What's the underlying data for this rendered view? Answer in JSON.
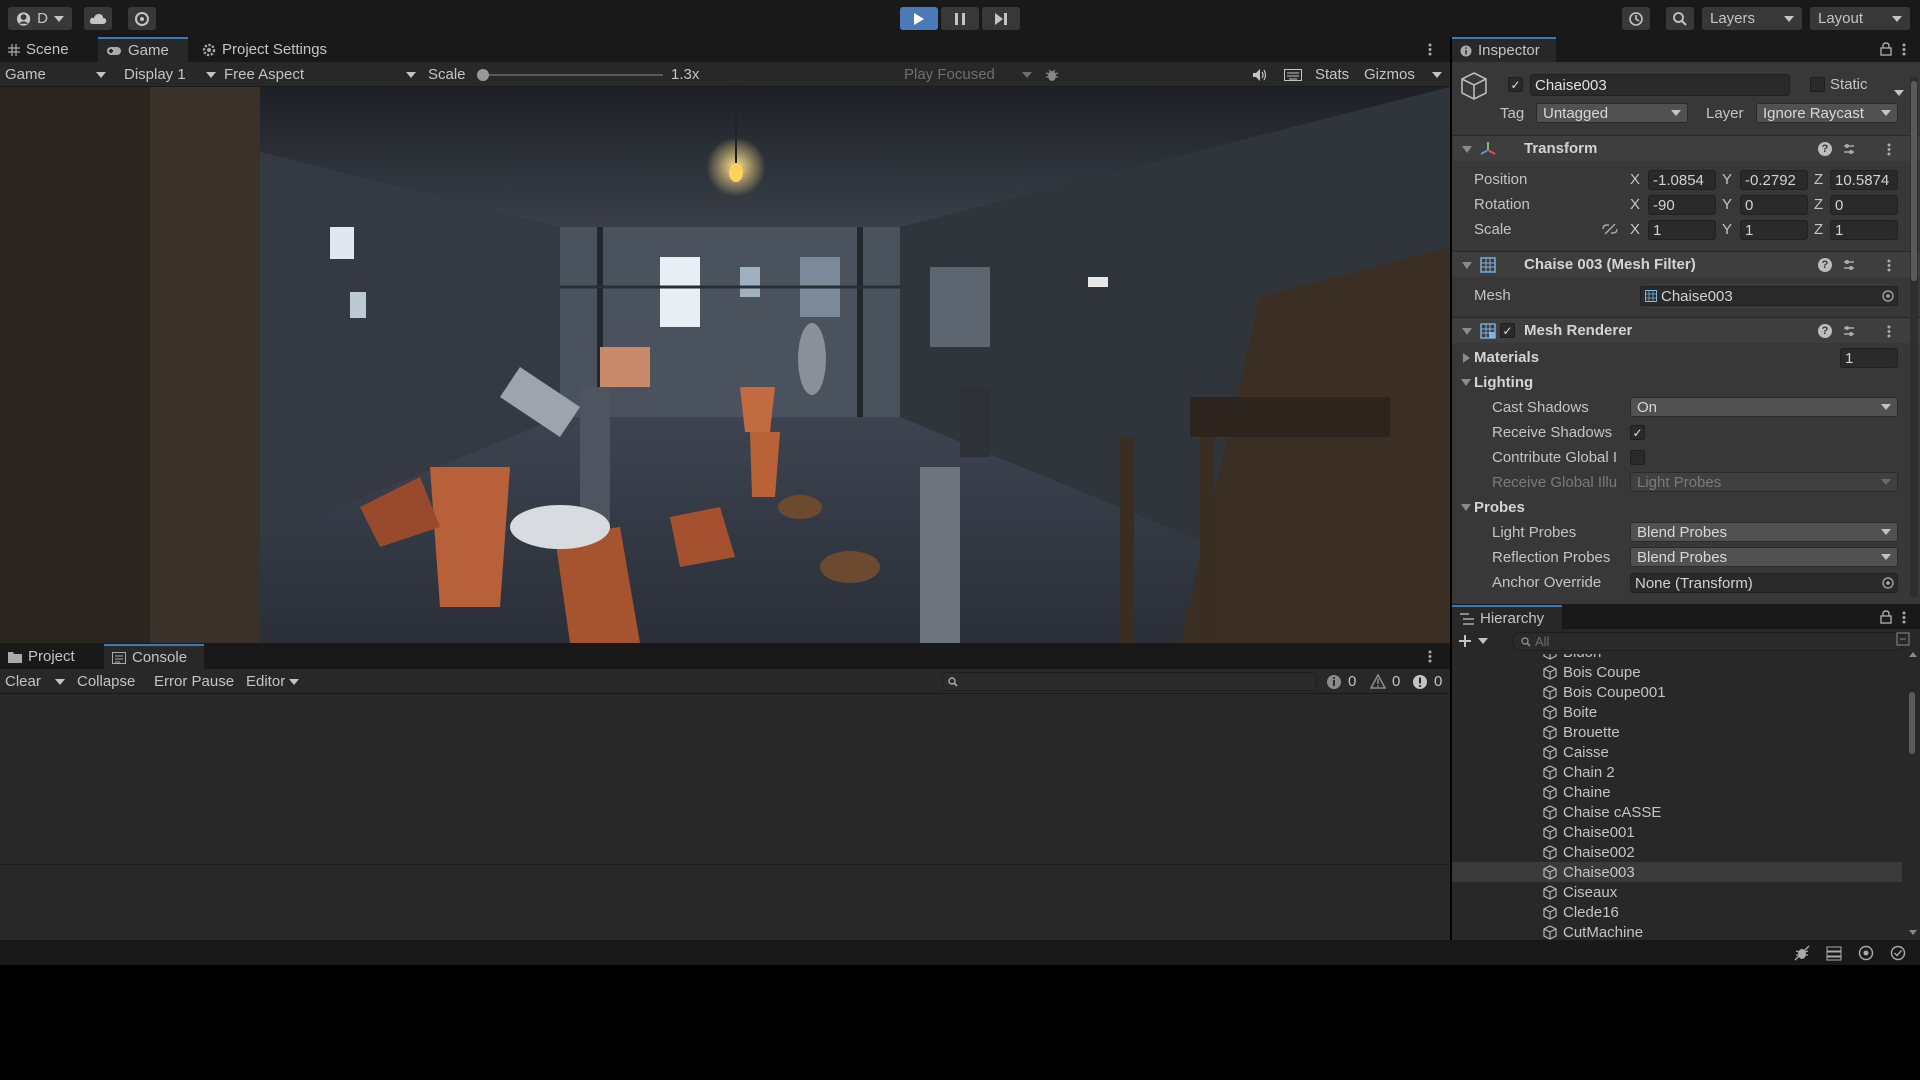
{
  "toolbar": {
    "account_initial": "D",
    "layers_label": "Layers",
    "layout_label": "Layout"
  },
  "left_tabs": [
    {
      "label": "Scene"
    },
    {
      "label": "Game"
    },
    {
      "label": "Project Settings"
    }
  ],
  "game_toolbar": {
    "mode": "Game",
    "display": "Display 1",
    "aspect": "Free Aspect",
    "scale_label": "Scale",
    "scale_value": "1.3x",
    "play_mode": "Play Focused",
    "stats": "Stats",
    "gizmos": "Gizmos"
  },
  "console_tabs": [
    {
      "label": "Project"
    },
    {
      "label": "Console"
    }
  ],
  "console_toolbar": {
    "clear": "Clear",
    "collapse": "Collapse",
    "error_pause": "Error Pause",
    "editor": "Editor",
    "log_count": "0",
    "warning_count": "0",
    "error_count": "0"
  },
  "inspector": {
    "tab": "Inspector",
    "object_name": "Chaise003",
    "static_label": "Static",
    "tag_label": "Tag",
    "tag_value": "Untagged",
    "layer_label": "Layer",
    "layer_value": "Ignore Raycast",
    "transform": {
      "title": "Transform",
      "position_label": "Position",
      "rotation_label": "Rotation",
      "scale_label": "Scale",
      "position": {
        "x": "-1.0854",
        "y": "-0.2792",
        "z": "10.5874"
      },
      "rotation": {
        "x": "-90",
        "y": "0",
        "z": "0"
      },
      "scale": {
        "x": "1",
        "y": "1",
        "z": "1"
      }
    },
    "mesh_filter": {
      "title": "Chaise 003 (Mesh Filter)",
      "mesh_label": "Mesh",
      "mesh_value": "Chaise003"
    },
    "mesh_renderer": {
      "title": "Mesh Renderer",
      "materials_label": "Materials",
      "materials_count": "1",
      "lighting_label": "Lighting",
      "cast_shadows_label": "Cast Shadows",
      "cast_shadows_value": "On",
      "receive_shadows_label": "Receive Shadows",
      "contribute_gi_label": "Contribute Global I",
      "receive_gi_label": "Receive Global Illu",
      "receive_gi_value": "Light Probes",
      "probes_label": "Probes",
      "light_probes_label": "Light Probes",
      "light_probes_value": "Blend Probes",
      "reflection_probes_label": "Reflection Probes",
      "reflection_probes_value": "Blend Probes",
      "anchor_override_label": "Anchor Override",
      "anchor_override_value": "None (Transform)"
    }
  },
  "hierarchy": {
    "tab": "Hierarchy",
    "search_placeholder": "All",
    "items": [
      {
        "label": "Bidon"
      },
      {
        "label": "Bois Coupe"
      },
      {
        "label": "Bois Coupe001"
      },
      {
        "label": "Boite"
      },
      {
        "label": "Brouette"
      },
      {
        "label": "Caisse"
      },
      {
        "label": "Chain 2"
      },
      {
        "label": "Chaine"
      },
      {
        "label": "Chaise cASSE"
      },
      {
        "label": "Chaise001"
      },
      {
        "label": "Chaise002"
      },
      {
        "label": "Chaise003",
        "selected": true
      },
      {
        "label": "Ciseaux"
      },
      {
        "label": "Clede16"
      },
      {
        "label": "CutMachine"
      }
    ]
  },
  "colors": {
    "accent": "#3a79bb",
    "play_active": "#4a7ab8",
    "panel": "#282828",
    "inspector_bg": "#383838"
  }
}
